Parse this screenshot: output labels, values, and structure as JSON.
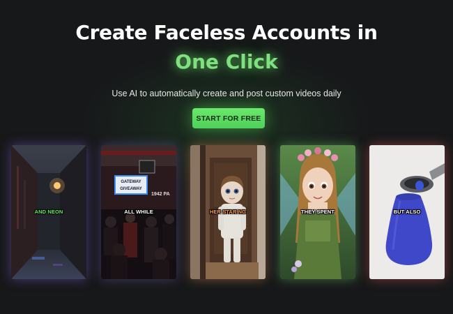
{
  "hero": {
    "title_line1": "Create Faceless Accounts in",
    "title_accent": "One Click",
    "subtitle": "Use AI to automatically create and post custom videos daily",
    "cta_label": "START FOR FREE"
  },
  "colors": {
    "background": "#17181a",
    "accent_green": "#7ee07e",
    "cta_green": "#5cdc62",
    "text": "#ffffff"
  },
  "cards": [
    {
      "caption": "AND NEON",
      "caption_color": "#5ef05e",
      "scene": "neon-alley-video-thumbnail"
    },
    {
      "caption": "ALL WHILE",
      "caption_color": "#ffffff",
      "scene": "crowded-casino-video-thumbnail",
      "sign_line1": "GATEWAY",
      "sign_line2": "GIVEAWAY",
      "wall_text": "1942 PA"
    },
    {
      "caption": "HER STARING",
      "caption_color": "#ff9a3c",
      "scene": "creepy-doll-video-thumbnail"
    },
    {
      "caption": "THEY SPENT",
      "caption_color": "#ffffff",
      "scene": "fairy-girl-video-thumbnail"
    },
    {
      "caption": "BUT ALSO",
      "caption_color": "#ffffff",
      "scene": "blue-clay-pottery-video-thumbnail"
    }
  ]
}
